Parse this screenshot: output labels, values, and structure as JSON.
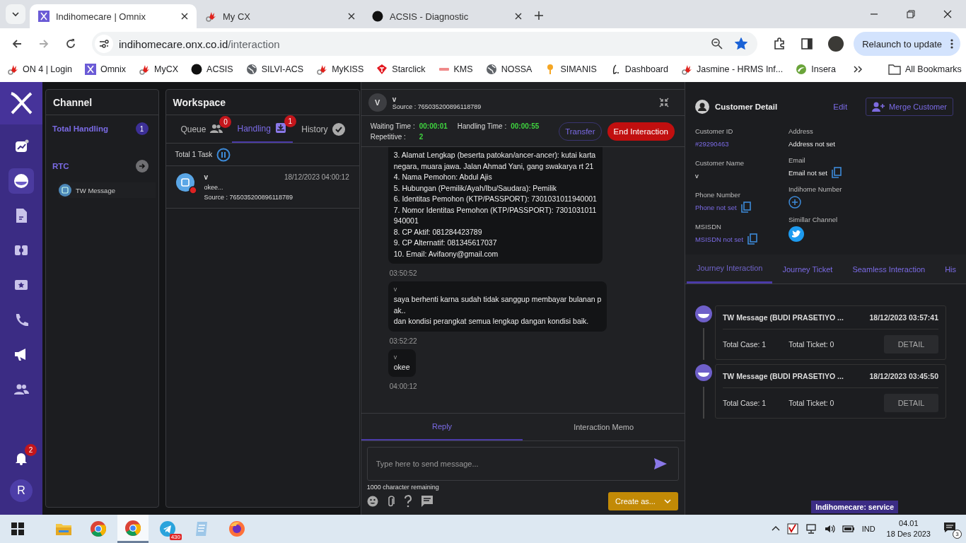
{
  "browser": {
    "tabs": [
      {
        "title": "Indihomecare | Omnix",
        "selected": true
      },
      {
        "title": "My CX",
        "selected": false
      },
      {
        "title": "ACSIS - Diagnostic",
        "selected": false
      }
    ],
    "url_host": "indihomecare.onx.co.id",
    "url_path": "/interaction",
    "bookmarked": true,
    "relaunch": "Relaunch to update",
    "bookmarks": [
      {
        "label": "ON 4 | Login"
      },
      {
        "label": "Omnix"
      },
      {
        "label": "MyCX"
      },
      {
        "label": "ACSIS"
      },
      {
        "label": "SILVI-ACS"
      },
      {
        "label": "MyKISS"
      },
      {
        "label": "Starclick"
      },
      {
        "label": "KMS"
      },
      {
        "label": "NOSSA"
      },
      {
        "label": "SIMANIS"
      },
      {
        "label": "Dashboard"
      },
      {
        "label": "Jasmine - HRMS Inf..."
      },
      {
        "label": "Insera"
      }
    ],
    "all_bookmarks": "All Bookmarks"
  },
  "nav": {
    "items": [
      {
        "selected": false
      },
      {
        "selected": true
      },
      {
        "selected": false
      },
      {
        "selected": false
      },
      {
        "selected": false
      },
      {
        "selected": false
      },
      {
        "selected": false
      },
      {
        "selected": false
      }
    ],
    "notifications": "2",
    "avatar": "R"
  },
  "channel": {
    "title": "Channel",
    "total_label": "Total Handling",
    "total": "1",
    "rtc": "RTC",
    "items": [
      {
        "label": "TW Message"
      }
    ]
  },
  "workspace": {
    "title": "Workspace",
    "tabs": [
      {
        "label": "Queue",
        "badge": "0",
        "selected": false
      },
      {
        "label": "Handling",
        "badge": "1",
        "selected": true
      },
      {
        "label": "History",
        "selected": false
      }
    ],
    "task_count": "Total 1 Task",
    "tasks": [
      {
        "name": "v",
        "time": "18/12/2023 04:00:12",
        "preview": "okee...",
        "source": "Source : 765035200896118789"
      }
    ]
  },
  "chat": {
    "avatar": "V",
    "name": "v",
    "source": "Source : 765035200896118789",
    "waiting_label": "Waiting Time :",
    "waiting": "00:00:01",
    "handling_label": "Handling Time :",
    "handling": "00:00:55",
    "repetitive_label": "Repetitive :",
    "repetitive": "2",
    "transfer": "Transfer",
    "end": "End Interaction",
    "messages": [
      {
        "text": "3. Alamat Lengkap (beserta patokan/ancer-ancer): kutai karta\nnegara, muara jawa. Jalan Ahmad Yani, gang swakarya rt 21\n4. Nama Pemohon: Abdul Ajis\n5. Hubungan (Pemilik/Ayah/Ibu/Saudara): Pemilik\n6. Identitas Pemohon (KTP/PASSPORT): 7301031011940001\n7. Nomor Identitas Pemohon (KTP/PASSPORT): 7301031011\n940001\n8. CP Aktif: 081284423789\n9. CP Alternatif: 081345617037\n10. Email: Avifaony@gmail.com",
        "time": "03:50:52"
      },
      {
        "sender": "v",
        "text": "saya berhenti karna sudah tidak sanggup membayar bulanan p\nak..\ndan kondisi perangkat semua lengkap dangan kondisi baik.",
        "time": "03:52:22"
      },
      {
        "sender": "v",
        "text": "okee",
        "time": "04:00:12"
      }
    ],
    "tabs": [
      {
        "label": "Reply",
        "selected": true
      },
      {
        "label": "Interaction Memo",
        "selected": false
      }
    ],
    "placeholder": "Type here to send message...",
    "remaining": "1000 character remaining",
    "create": "Create as..."
  },
  "customer": {
    "title": "Customer Detail",
    "edit": "Edit",
    "merge": "Merge Customer",
    "left": [
      {
        "label": "Customer ID",
        "value": "#29290463",
        "kind": "link"
      },
      {
        "label": "Customer Name",
        "value": "v",
        "kind": "plain"
      },
      {
        "label": "Phone Number",
        "value": "Phone not set",
        "kind": "linkcopy"
      },
      {
        "label": "MSISDN",
        "value": "MSISDN not set",
        "kind": "linkcopy"
      }
    ],
    "right": [
      {
        "label": "Address",
        "value": "Address not set",
        "kind": "plain"
      },
      {
        "label": "Email",
        "value": "Email not set",
        "kind": "plaincopy"
      },
      {
        "label": "Indihome Number",
        "kind": "add"
      },
      {
        "label": "Simillar Channel",
        "kind": "twitter"
      }
    ],
    "tabs": [
      {
        "label": "Journey Interaction",
        "selected": true
      },
      {
        "label": "Journey Ticket",
        "selected": false
      },
      {
        "label": "Seamless Interaction",
        "selected": false
      },
      {
        "label": "His",
        "selected": false
      }
    ],
    "journeys": [
      {
        "title": "TW Message (BUDI PRASETIYO ...",
        "time": "18/12/2023 03:57:41",
        "cases": "Total Case: 1",
        "tickets": "Total Ticket: 0",
        "button": "DETAIL"
      },
      {
        "title": "TW Message (BUDI PRASETIYO ...",
        "time": "18/12/2023 03:45:50",
        "cases": "Total Case: 1",
        "tickets": "Total Ticket: 0",
        "button": "DETAIL"
      }
    ]
  },
  "tooltip": "Indihomecare: service",
  "taskbar": {
    "apps": [
      {
        "selected": false
      },
      {
        "selected": false
      },
      {
        "selected": true
      },
      {
        "badge": "430",
        "selected": false
      },
      {
        "selected": false
      },
      {
        "selected": false
      }
    ],
    "language": "IND",
    "time": "04.01",
    "date": "18 Des 2023",
    "notifications": "3"
  }
}
